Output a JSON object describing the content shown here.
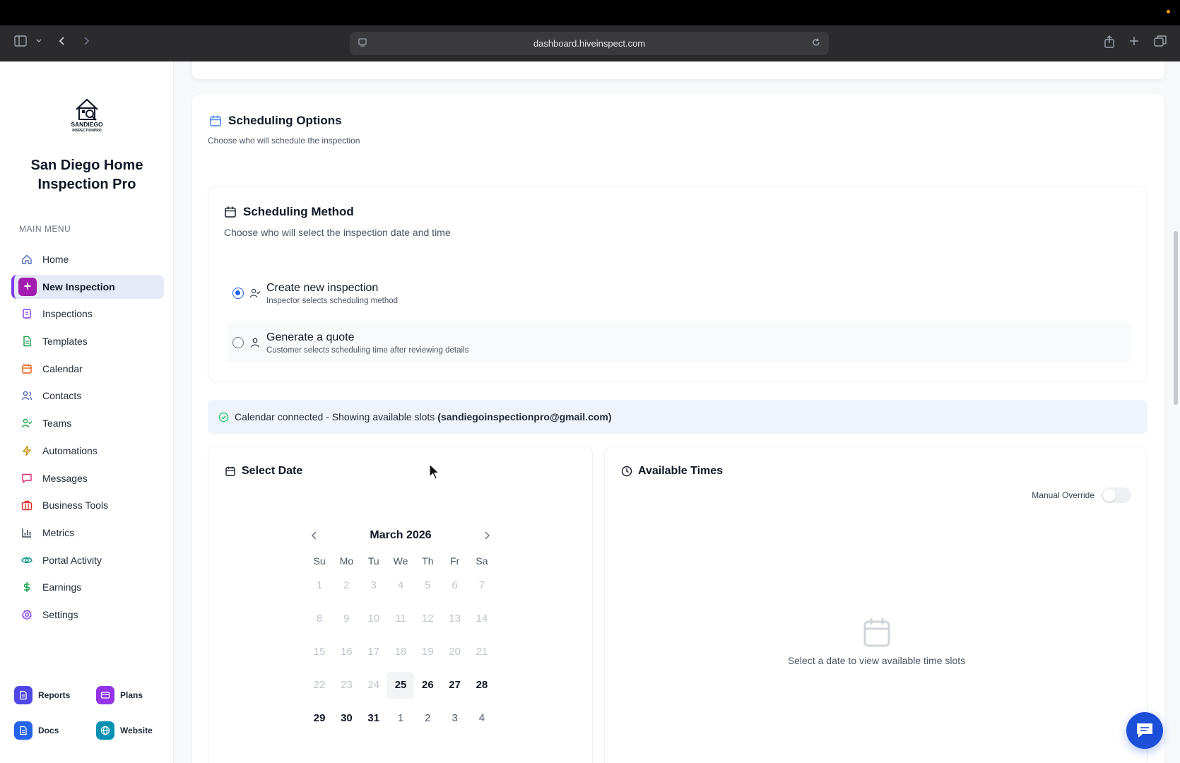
{
  "browser": {
    "url": "dashboard.hiveinspect.com"
  },
  "sidebar": {
    "logo_text": "SANDIEGO INSPECTIONPRO",
    "business_name_line1": "San Diego Home",
    "business_name_line2": "Inspection Pro",
    "menu_label": "MAIN MENU",
    "items": [
      {
        "label": "Home",
        "icon": "home-icon",
        "color": "#4b6cb7"
      },
      {
        "label": "New Inspection",
        "icon": "plus-icon",
        "color": "#a21caf",
        "active": true
      },
      {
        "label": "Inspections",
        "icon": "list-icon",
        "color": "#7c3aed"
      },
      {
        "label": "Templates",
        "icon": "file-icon",
        "color": "#16a34a"
      },
      {
        "label": "Calendar",
        "icon": "calendar-icon",
        "color": "#ea580c"
      },
      {
        "label": "Contacts",
        "icon": "users-icon",
        "color": "#4b6cb7"
      },
      {
        "label": "Teams",
        "icon": "user-check-icon",
        "color": "#16a34a"
      },
      {
        "label": "Automations",
        "icon": "bolt-icon",
        "color": "#ca8a04"
      },
      {
        "label": "Messages",
        "icon": "message-icon",
        "color": "#db2777"
      },
      {
        "label": "Business Tools",
        "icon": "briefcase-icon",
        "color": "#dc2626"
      },
      {
        "label": "Metrics",
        "icon": "bar-chart-icon",
        "color": "#374151"
      },
      {
        "label": "Portal Activity",
        "icon": "eye-icon",
        "color": "#0d9488"
      },
      {
        "label": "Earnings",
        "icon": "dollar-icon",
        "color": "#16a34a"
      },
      {
        "label": "Settings",
        "icon": "gear-icon",
        "color": "#7c3aed"
      }
    ],
    "bottom": {
      "reports": "Reports",
      "plans": "Plans",
      "docs": "Docs",
      "website": "Website"
    }
  },
  "main": {
    "section_title": "Scheduling Options",
    "section_subtitle": "Choose who will schedule the inspection",
    "method": {
      "title": "Scheduling Method",
      "subtitle": "Choose who will select the inspection date and time",
      "option1_title": "Create new inspection",
      "option1_sub": "Inspector selects scheduling method",
      "option2_title": "Generate a quote",
      "option2_sub": "Customer selects scheduling time after reviewing details",
      "selected": "Create new inspection"
    },
    "banner": {
      "text": "Calendar connected - Showing available slots",
      "email": "(sandiegoinspectionpro@gmail.com)"
    },
    "date": {
      "title": "Select Date",
      "month": "March 2026",
      "weekdays": [
        "Su",
        "Mo",
        "Tu",
        "We",
        "Th",
        "Fr",
        "Sa"
      ],
      "weeks": [
        [
          "1",
          "2",
          "3",
          "4",
          "5",
          "6",
          "7"
        ],
        [
          "8",
          "9",
          "10",
          "11",
          "12",
          "13",
          "14"
        ],
        [
          "15",
          "16",
          "17",
          "18",
          "19",
          "20",
          "21"
        ],
        [
          "22",
          "23",
          "24",
          "25",
          "26",
          "27",
          "28"
        ],
        [
          "29",
          "30",
          "31",
          "1",
          "2",
          "3",
          "4"
        ]
      ],
      "today": "25"
    },
    "times": {
      "title": "Available Times",
      "override_label": "Manual Override",
      "override_on": false,
      "empty_text": "Select a date to view available time slots"
    }
  },
  "colors": {
    "accent": "#2563eb",
    "active_nav": "#a21caf"
  }
}
